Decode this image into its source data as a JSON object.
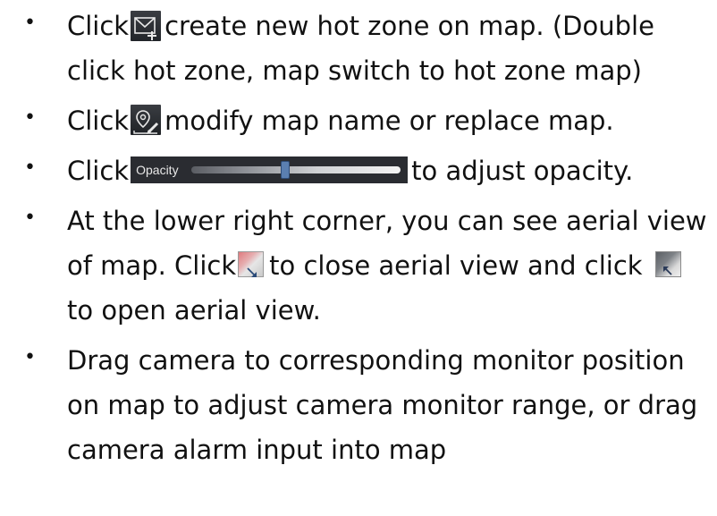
{
  "bullet_char": "•",
  "items": [
    {
      "parts": {
        "before_icon": "Click",
        "after_icon": "create new hot zone on map. (Double",
        "line2": "click hot zone, map switch to hot zone map)"
      },
      "icon": "create-hot-zone-icon"
    },
    {
      "parts": {
        "before_icon": "Click",
        "after_icon": "modify map name or replace map."
      },
      "icon": "modify-map-icon"
    },
    {
      "parts": {
        "before_widget": "Click",
        "after_widget": "to adjust opacity."
      },
      "opacity_widget": {
        "label": "Opacity",
        "level": 0.45
      }
    },
    {
      "parts": {
        "line1": "At the lower right corner, you can see aerial view",
        "line2_before": "of map. Click",
        "line2_middle": "to close aerial view and click",
        "line3": "to open aerial view."
      },
      "icons": [
        "close-aerial-view-icon",
        "open-aerial-view-icon"
      ]
    },
    {
      "parts": {
        "line1": "Drag camera to corresponding monitor position",
        "line2": "on map to adjust camera monitor range, or drag",
        "line3": "camera alarm input into map"
      }
    }
  ],
  "colors": {
    "text": "#111111",
    "icon_dark": "#2a2c31",
    "icon_stroke": "#e8e8e8",
    "knob": "#5b7fb0"
  }
}
